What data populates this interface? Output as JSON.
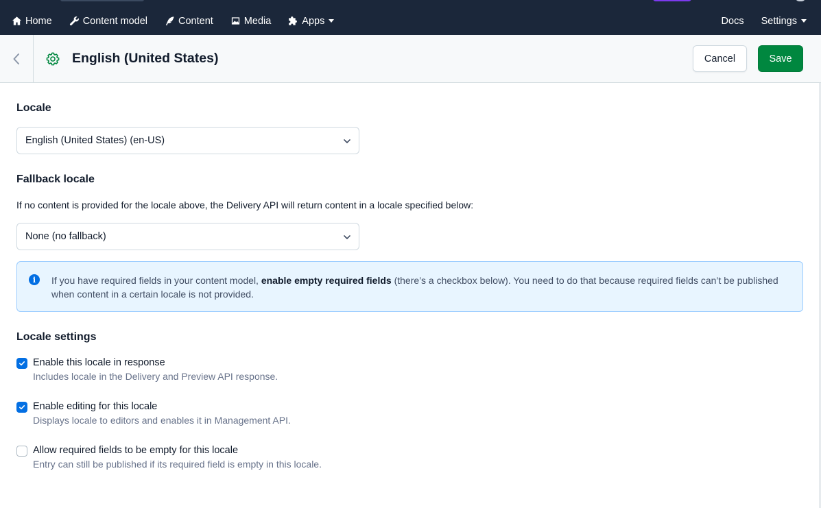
{
  "nav": {
    "items": [
      {
        "label": "Home",
        "icon": "home-icon"
      },
      {
        "label": "Content model",
        "icon": "wrench-icon"
      },
      {
        "label": "Content",
        "icon": "feather-pen-icon"
      },
      {
        "label": "Media",
        "icon": "image-icon"
      },
      {
        "label": "Apps",
        "icon": "puzzle-icon"
      }
    ],
    "right": [
      {
        "label": "Docs"
      },
      {
        "label": "Settings"
      }
    ]
  },
  "header": {
    "title": "English (United States)",
    "icon": "gear-icon",
    "cancel_label": "Cancel",
    "save_label": "Save"
  },
  "form": {
    "locale_title": "Locale",
    "locale_value": "English (United States) (en-US)",
    "fallback_title": "Fallback locale",
    "fallback_desc": "If no content is provided for the locale above, the Delivery API will return content in a locale specified below:",
    "fallback_value": "None (no fallback)",
    "note": {
      "before": "If you have required fields in your content model, ",
      "bold": "enable empty required fields",
      "after": " (there’s a checkbox below). You need to do that because required fields can’t be published when content in a certain locale is not provided."
    },
    "settings_title": "Locale settings",
    "options": [
      {
        "label": "Enable this locale in response",
        "help": "Includes locale in the Delivery and Preview API response.",
        "checked": true
      },
      {
        "label": "Enable editing for this locale",
        "help": "Displays locale to editors and enables it in Management API.",
        "checked": true
      },
      {
        "label": "Allow required fields to be empty for this locale",
        "help": "Entry can still be published if its required field is empty in this locale.",
        "checked": false
      }
    ]
  },
  "colors": {
    "nav_bg": "#1b273a",
    "primary_blue": "#036fe3",
    "save_green": "#00873f",
    "note_bg": "#e8f5ff"
  }
}
